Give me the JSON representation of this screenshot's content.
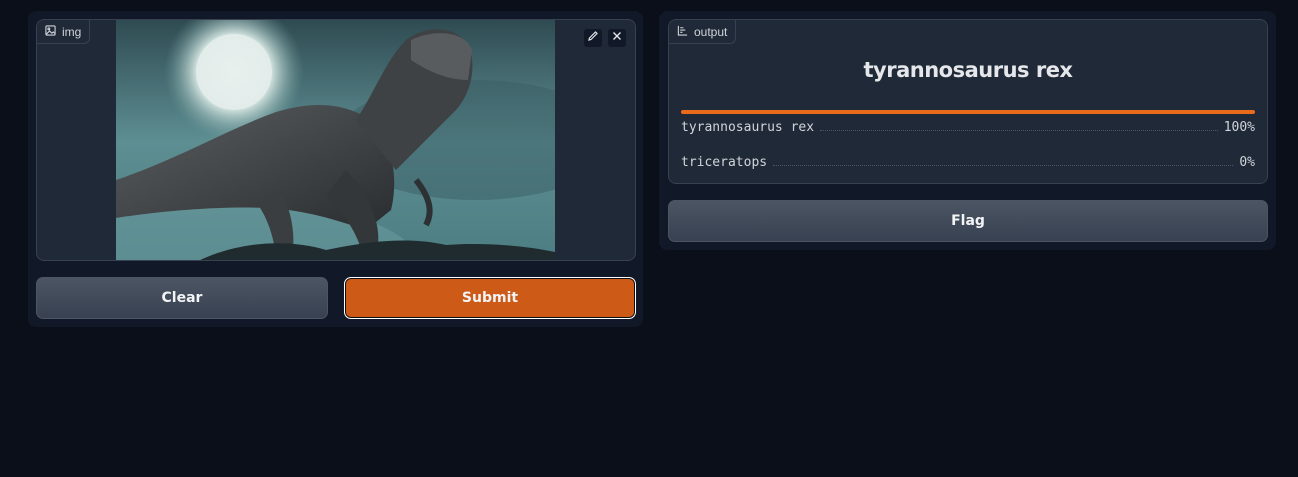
{
  "input": {
    "label": "img",
    "image_alt": "Tyrannosaurus rex on a rocky ledge under a moonlit teal sky"
  },
  "buttons": {
    "clear": "Clear",
    "submit": "Submit",
    "flag": "Flag"
  },
  "output": {
    "label": "output",
    "top_label": "tyrannosaurus rex",
    "confidences": [
      {
        "label": "tyrannosaurus rex",
        "value": "100%",
        "fraction": 1.0
      },
      {
        "label": "triceratops",
        "value": "0%",
        "fraction": 0.0
      }
    ]
  },
  "colors": {
    "background": "#0b0f19",
    "panel": "#111827",
    "block": "#1f2937",
    "accent": "#cd5a16",
    "bar": "#ea6a1c"
  }
}
